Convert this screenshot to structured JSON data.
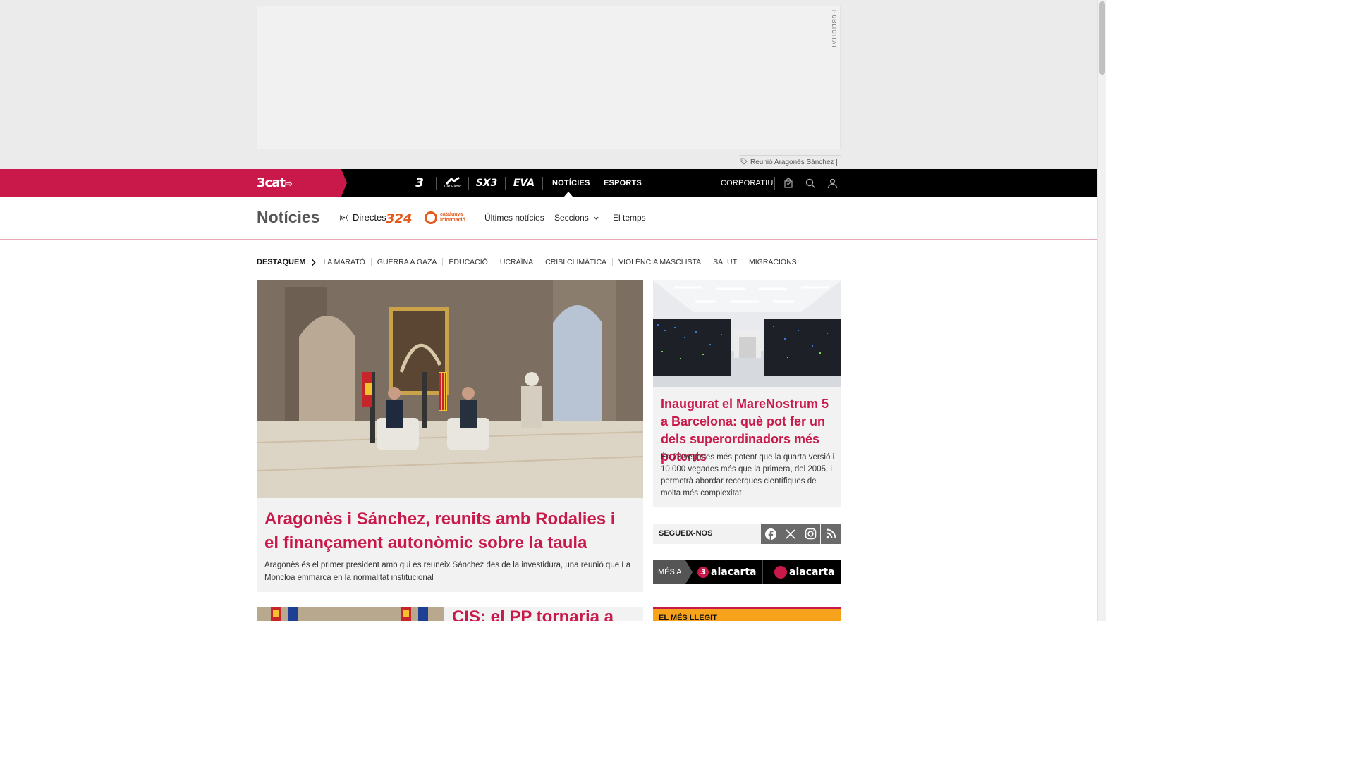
{
  "ad": {
    "label": "PUBLICITAT",
    "ticker_text": "Reunió Aragonès Sánchez |"
  },
  "topnav": {
    "brand": "3cat",
    "channels": [
      "3",
      "Cat Ràdio",
      "SX3",
      "EVA"
    ],
    "links": [
      {
        "label": "NOTÍCIES",
        "active": true
      },
      {
        "label": "ESPORTS",
        "active": false
      }
    ],
    "corporate": "CORPORATIU",
    "tools": [
      "shopping-bag-icon",
      "search-icon",
      "user-icon"
    ]
  },
  "section": {
    "title": "Notícies",
    "directes": "Directes",
    "logo_324": "324",
    "logo_catinfo": "catalunya informació",
    "links": [
      "Últimes notícies",
      "Seccions",
      "El temps"
    ]
  },
  "destaquem": {
    "lead": "DESTAQUEM",
    "items": [
      "LA MARATÓ",
      "GUERRA A GAZA",
      "EDUCACIÓ",
      "UCRAÏNA",
      "CRISI CLIMÀTICA",
      "VIOLÈNCIA MASCLISTA",
      "SALUT",
      "MIGRACIONS"
    ]
  },
  "main_article": {
    "title": "Aragonès i Sánchez, reunits amb Rodalies i el finançament autonòmic sobre la taula",
    "lead": "Aragonès és el primer president amb qui es reuneix Sánchez des de la investidura, una reunió que La Moncloa emmarca en la normalitat institucional"
  },
  "side_article": {
    "title": "Inaugurat el MareNostrum 5 a Barcelona: què pot fer un dels superordinadors més potents",
    "lead": "És 23 vegades més potent que la quarta versió i 10.000 vegades més que la primera, del 2005, i permetrà abordar recerques científiques de molta més complexitat"
  },
  "follow": {
    "label": "SEGUEIX-NOS",
    "networks": [
      "facebook-icon",
      "x-icon",
      "instagram-icon",
      "rss-icon"
    ]
  },
  "mes_a": {
    "label": "MÉS A",
    "items": [
      "alacarta",
      "alacarta"
    ]
  },
  "second_article": {
    "title": "CIS: el PP tornaria a"
  },
  "most_read": {
    "label": "EL MÉS LLEGIT"
  },
  "colors": {
    "brand": "#c8194a",
    "nav_bg": "#000000",
    "orange": "#e5591c",
    "accent_yellow": "#f7a21b"
  }
}
